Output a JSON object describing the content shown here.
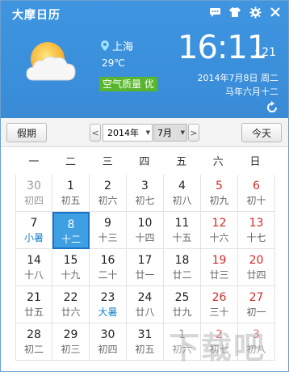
{
  "app": {
    "title": "大摩日历"
  },
  "weather": {
    "location": "上海",
    "temperature": "29℃",
    "aqi": "空气质量 优"
  },
  "clock": {
    "time": "16:11",
    "seconds": ": 21",
    "date": "2014年7月8日  周二",
    "lunar": "马年六月十二"
  },
  "toolbar": {
    "holiday_label": "假期",
    "prev_label": "<",
    "next_label": ">",
    "year_value": "2014年",
    "month_value": "7月",
    "today_label": "今天"
  },
  "weekdays": [
    "一",
    "二",
    "三",
    "四",
    "五",
    "六",
    "日"
  ],
  "days": [
    {
      "d": "30",
      "l": "初四",
      "other": true
    },
    {
      "d": "1",
      "l": "初五"
    },
    {
      "d": "2",
      "l": "初六"
    },
    {
      "d": "3",
      "l": "初七"
    },
    {
      "d": "4",
      "l": "初八"
    },
    {
      "d": "5",
      "l": "初九",
      "weekend": true
    },
    {
      "d": "6",
      "l": "初十",
      "weekend": true
    },
    {
      "d": "7",
      "l": "小暑",
      "term": true
    },
    {
      "d": "8",
      "l": "十二",
      "today": true
    },
    {
      "d": "9",
      "l": "十三"
    },
    {
      "d": "10",
      "l": "十四"
    },
    {
      "d": "11",
      "l": "十五"
    },
    {
      "d": "12",
      "l": "十六",
      "weekend": true
    },
    {
      "d": "13",
      "l": "十七",
      "weekend": true
    },
    {
      "d": "14",
      "l": "十八"
    },
    {
      "d": "15",
      "l": "十九"
    },
    {
      "d": "16",
      "l": "二十"
    },
    {
      "d": "17",
      "l": "廿一"
    },
    {
      "d": "18",
      "l": "廿二"
    },
    {
      "d": "19",
      "l": "廿三",
      "weekend": true
    },
    {
      "d": "20",
      "l": "廿四",
      "weekend": true
    },
    {
      "d": "21",
      "l": "廿五"
    },
    {
      "d": "22",
      "l": "廿六"
    },
    {
      "d": "23",
      "l": "大暑",
      "term": true
    },
    {
      "d": "24",
      "l": "廿八"
    },
    {
      "d": "25",
      "l": "廿九"
    },
    {
      "d": "26",
      "l": "三十",
      "weekend": true
    },
    {
      "d": "27",
      "l": "初一",
      "weekend": true
    },
    {
      "d": "28",
      "l": "初二"
    },
    {
      "d": "29",
      "l": "初三"
    },
    {
      "d": "30",
      "l": "初四"
    },
    {
      "d": "31",
      "l": "初五"
    },
    {
      "d": "1",
      "l": "初六",
      "other": true
    },
    {
      "d": "2",
      "l": "初七",
      "other": true,
      "weekend": true
    },
    {
      "d": "3",
      "l": "初八",
      "other": true,
      "weekend": true
    }
  ],
  "watermark": "下载吧"
}
